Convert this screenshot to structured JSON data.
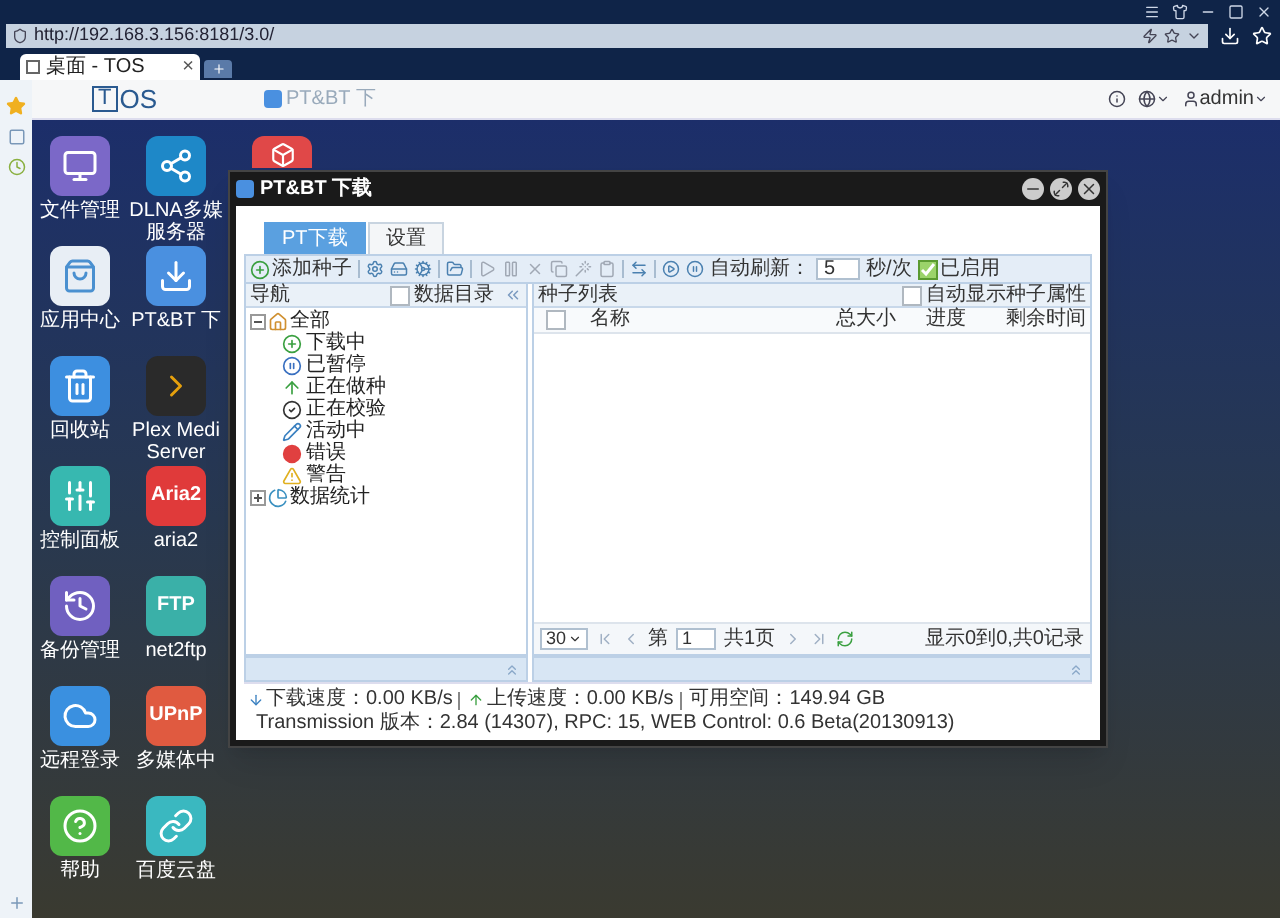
{
  "browser": {
    "address": "http://192.168.3.156:8181/3.0/",
    "tab": {
      "title": "桌面 - TOS",
      "close": "×"
    }
  },
  "header": {
    "logo_box": "T",
    "logo_text": "OS",
    "task": "PT&BT 下",
    "user": "admin"
  },
  "desktop_icons": [
    {
      "label": "文件管理"
    },
    {
      "label": "应用中心"
    },
    {
      "label": "回收站"
    },
    {
      "label": "控制面板"
    },
    {
      "label": "备份管理"
    },
    {
      "label": "远程登录"
    },
    {
      "label": "帮助"
    },
    {
      "label": "DLNA多媒服务器"
    },
    {
      "label": "PT&BT 下"
    },
    {
      "label": "Plex Medi Server"
    },
    {
      "label": "aria2",
      "icon_text": "Aria2"
    },
    {
      "label": "net2ftp",
      "icon_text": "FTP"
    },
    {
      "label": "多媒体中",
      "icon_text": "UPnP"
    },
    {
      "label": "百度云盘"
    }
  ],
  "window": {
    "title": "PT&BT 下载",
    "tabs": [
      {
        "label": "PT下载",
        "selected": true
      },
      {
        "label": "设置",
        "selected": false
      }
    ],
    "toolbar": {
      "add": "添加种子",
      "auto_refresh_label": "自动刷新：",
      "interval": "5",
      "unit": "秒/次",
      "enabled": {
        "label": "已启用",
        "checked": true
      }
    },
    "nav": {
      "title": "导航",
      "data_dir": {
        "label": "数据目录",
        "checked": false
      },
      "tree": [
        {
          "label": "全部",
          "expanded": true,
          "children": [
            {
              "label": "下载中"
            },
            {
              "label": "已暂停"
            },
            {
              "label": "正在做种"
            },
            {
              "label": "正在校验"
            },
            {
              "label": "活动中"
            },
            {
              "label": "错误"
            },
            {
              "label": "警告"
            }
          ]
        },
        {
          "label": "数据统计",
          "expanded": false
        }
      ]
    },
    "list": {
      "title": "种子列表",
      "auto_show": {
        "label": "自动显示种子属性",
        "checked": false
      },
      "select_all": {
        "checked": false
      },
      "columns": [
        "名称",
        "总大小",
        "进度",
        "剩余时间"
      ]
    },
    "pager": {
      "page_size": "30",
      "page_prefix": "第",
      "page": "1",
      "total_pages": "共1页",
      "summary": "显示0到0,共0记录"
    },
    "status": [
      {
        "kind": "download",
        "text": "下载速度：0.00 KB/s"
      },
      {
        "kind": "upload",
        "text": "上传速度：0.00 KB/s"
      },
      {
        "kind": "space",
        "text": "可用空间：149.94 GB"
      },
      {
        "kind": "version",
        "text": "Transmission 版本：2.84 (14307), RPC: 15, WEB Control: 0.6 Beta(20130913)"
      }
    ]
  }
}
